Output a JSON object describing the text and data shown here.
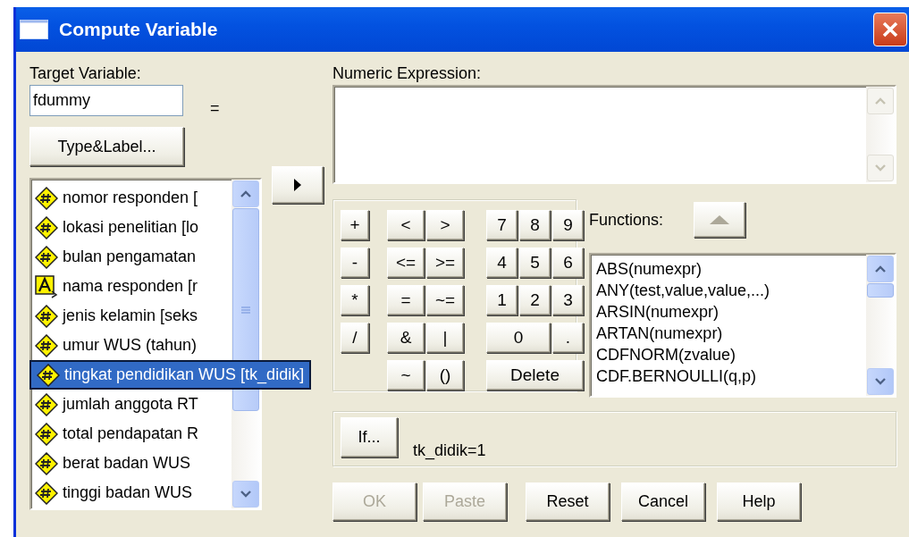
{
  "window": {
    "title": "Compute Variable"
  },
  "target_variable": {
    "label": "Target Variable:",
    "value": "fdummy",
    "equals": "="
  },
  "type_label_button": "Type&Label...",
  "variables": [
    {
      "name": "nomor responden [",
      "kind": "numeric",
      "selected": false
    },
    {
      "name": "lokasi penelitian [lo",
      "kind": "numeric",
      "selected": false
    },
    {
      "name": "bulan pengamatan",
      "kind": "numeric",
      "selected": false
    },
    {
      "name": "nama responden [r",
      "kind": "string",
      "selected": false
    },
    {
      "name": "jenis kelamin [seks",
      "kind": "numeric",
      "selected": false
    },
    {
      "name": "umur WUS (tahun)",
      "kind": "numeric",
      "selected": false
    },
    {
      "name": "tingkat pendidikan WUS [tk_didik]",
      "kind": "numeric",
      "selected": true
    },
    {
      "name": "jumlah anggota RT",
      "kind": "numeric",
      "selected": false
    },
    {
      "name": "total pendapatan R",
      "kind": "numeric",
      "selected": false
    },
    {
      "name": "berat badan WUS",
      "kind": "numeric",
      "selected": false
    },
    {
      "name": "tinggi badan WUS",
      "kind": "numeric",
      "selected": false
    }
  ],
  "numeric_expression": {
    "label": "Numeric Expression:"
  },
  "keypad": {
    "operators": [
      "+",
      "-",
      "*",
      "/"
    ],
    "relations": [
      [
        "<",
        ">"
      ],
      [
        "<=",
        ">="
      ],
      [
        "=",
        "~="
      ],
      [
        "&",
        "|"
      ],
      [
        "~",
        "()"
      ]
    ],
    "digits": [
      [
        "7",
        "8",
        "9"
      ],
      [
        "4",
        "5",
        "6"
      ],
      [
        "1",
        "2",
        "3"
      ],
      [
        "0",
        "."
      ],
      [
        "Delete"
      ]
    ]
  },
  "functions": {
    "label": "Functions:",
    "items": [
      "ABS(numexpr)",
      "ANY(test,value,value,...)",
      "ARSIN(numexpr)",
      "ARTAN(numexpr)",
      "CDFNORM(zvalue)",
      "CDF.BERNOULLI(q,p)"
    ]
  },
  "if_condition": {
    "button": "If...",
    "condition": "tk_didik=1"
  },
  "buttons": [
    {
      "label": "OK",
      "disabled": true
    },
    {
      "label": "Paste",
      "disabled": true
    },
    {
      "label": "Reset",
      "disabled": false
    },
    {
      "label": "Cancel",
      "disabled": false
    },
    {
      "label": "Help",
      "disabled": false
    }
  ]
}
